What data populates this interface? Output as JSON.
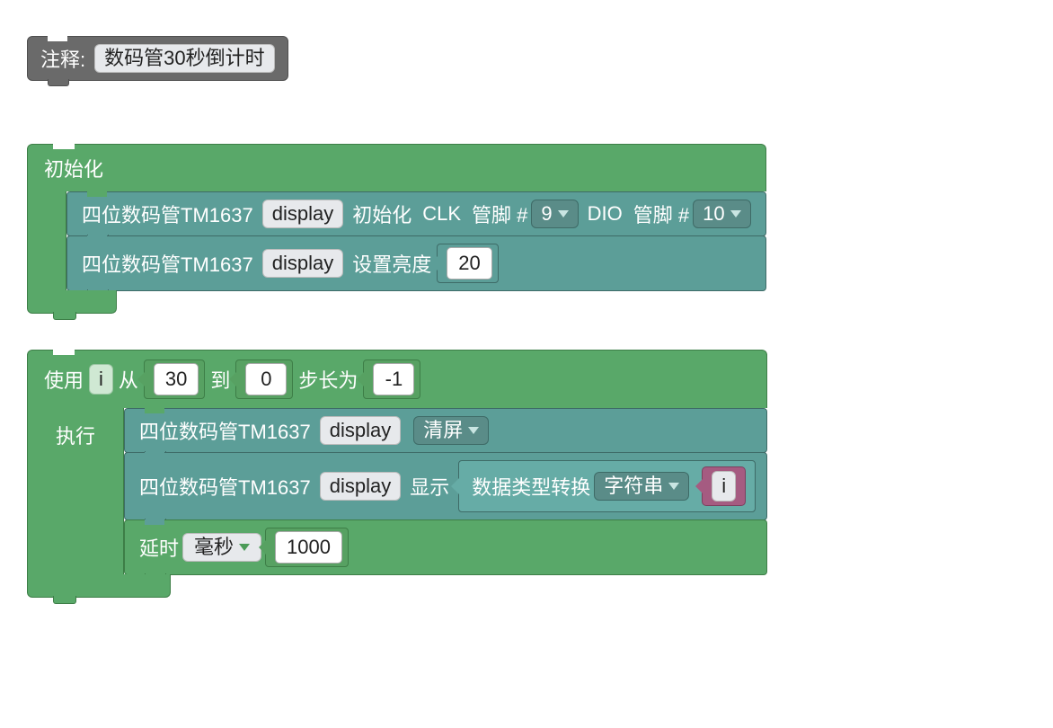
{
  "comment": {
    "label": "注释:",
    "text": "数码管30秒倒计时"
  },
  "setup": {
    "title": "初始化",
    "init": {
      "prefix": "四位数码管TM1637",
      "obj": "display",
      "init_word": "初始化",
      "clk_label": "CLK",
      "pin_word": "管脚 #",
      "clk_pin": "9",
      "dio_label": "DIO",
      "dio_pin": "10"
    },
    "brightness": {
      "prefix": "四位数码管TM1637",
      "obj": "display",
      "label": "设置亮度",
      "value": "20"
    }
  },
  "loop": {
    "use": "使用",
    "var": "i",
    "from": "从",
    "from_val": "30",
    "to": "到",
    "to_val": "0",
    "step": "步长为",
    "step_val": "-1",
    "exec": "执行",
    "clear": {
      "prefix": "四位数码管TM1637",
      "obj": "display",
      "action": "清屏"
    },
    "show": {
      "prefix": "四位数码管TM1637",
      "obj": "display",
      "label": "显示",
      "cast_label": "数据类型转换",
      "cast_type": "字符串",
      "var": "i"
    },
    "delay": {
      "label": "延时",
      "unit": "毫秒",
      "value": "1000"
    }
  }
}
